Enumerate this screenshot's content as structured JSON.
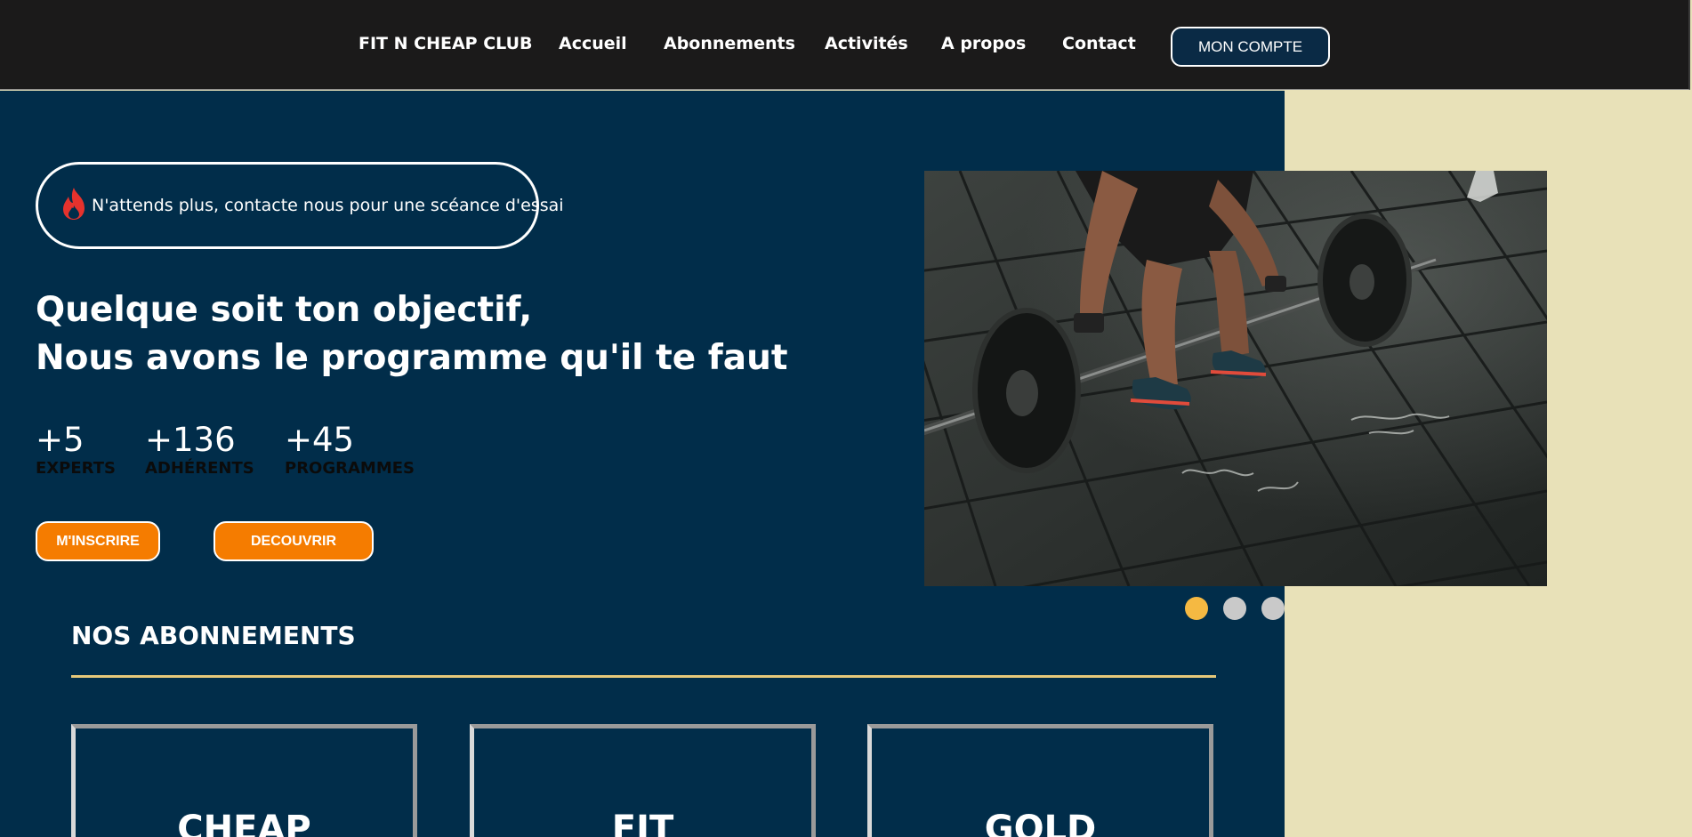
{
  "nav": {
    "brand": "FIT N CHEAP CLUB",
    "links": [
      "Accueil",
      "Abonnements",
      "Activités",
      "A propos",
      "Contact"
    ],
    "account_button": "MON COMPTE"
  },
  "hero": {
    "promo_text": "N'attends plus, contacte nous pour une scéance d'essai",
    "headline_line1": "Quelque soit ton objectif,",
    "headline_line2": "Nous avons le programme qu'il te faut",
    "stats": [
      {
        "value": "+5",
        "label": "EXPERTS"
      },
      {
        "value": "+136",
        "label": "ADHÉRENTS"
      },
      {
        "value": "+45",
        "label": "PROGRAMMES"
      }
    ],
    "buttons": {
      "signup": "M'INSCRIRE",
      "discover": "DECOUVRIR"
    }
  },
  "carousel": {
    "slide_count": 3,
    "active_index": 0
  },
  "subscriptions": {
    "title": "NOS ABONNEMENTS",
    "plans": [
      "CHEAP",
      "FIT",
      "GOLD"
    ]
  },
  "icons": {
    "promo": "fire-icon"
  },
  "colors": {
    "navbar_bg": "#1b1a1a",
    "hero_bg": "#012d4a",
    "side_panel": "#e8e1b8",
    "accent_orange": "#f57c00",
    "dot_active": "#f5b942",
    "dot_inactive": "#c9c9c9",
    "rule": "#e6c87a",
    "fire": "#e5322d"
  }
}
